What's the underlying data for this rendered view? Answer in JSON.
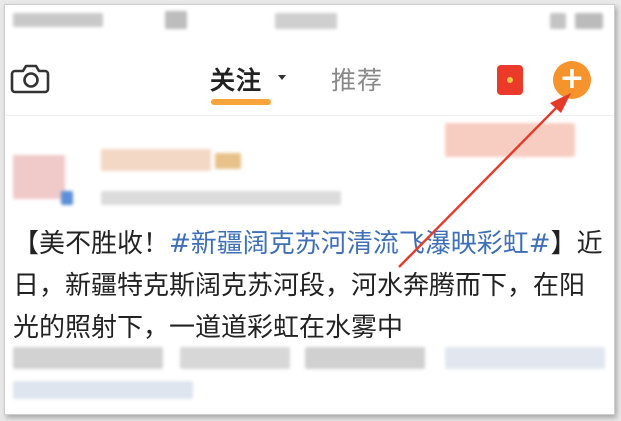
{
  "header": {
    "camera_icon": "camera-icon",
    "tab_follow": "关注",
    "tab_recommend": "推荐",
    "red_packet_icon": "red-packet-icon",
    "add_button_symbol": "+"
  },
  "post": {
    "text_open": "【美不胜收！",
    "hashtag": "#新疆阔克苏河清流飞瀑映彩虹#",
    "text_close": "】",
    "body": "近日，新疆特克斯阔克苏河段，河水奔腾而下，在阳光的照射下，一道道彩虹在水雾中"
  },
  "colors": {
    "accent_orange": "#f5942c",
    "tab_underline": "#f7a53a",
    "hashtag_blue": "#3f6fb6",
    "annotation_arrow": "#e53a2a"
  }
}
